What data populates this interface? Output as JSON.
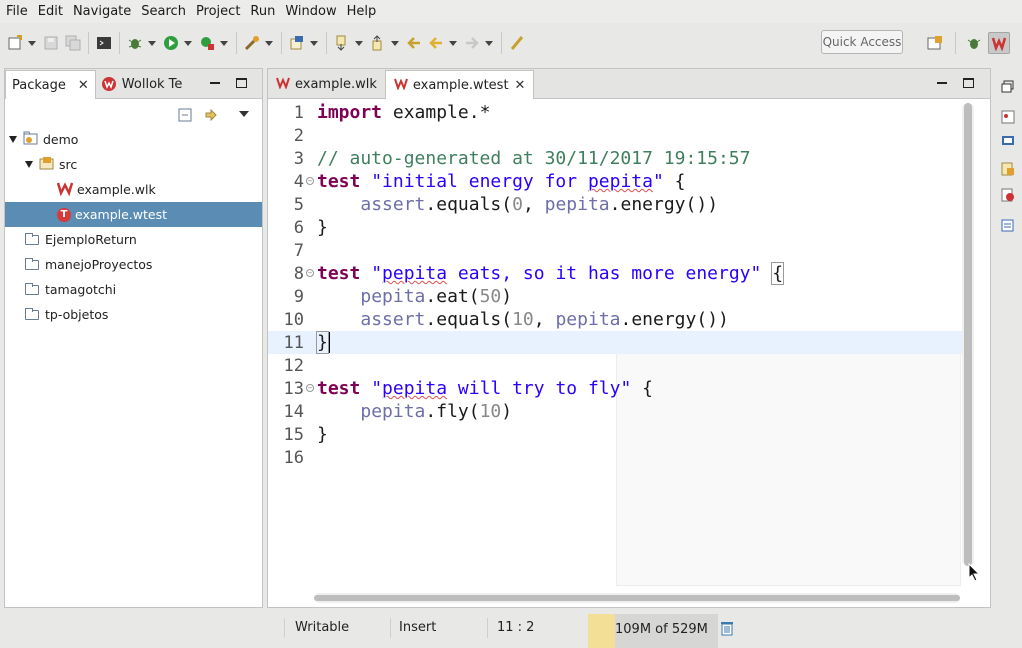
{
  "menu": [
    "File",
    "Edit",
    "Navigate",
    "Search",
    "Project",
    "Run",
    "Window",
    "Help"
  ],
  "toolbar": {
    "quick_access": "Quick Access",
    "icons": [
      "new-icon",
      "save-icon",
      "save-all-icon",
      "terminal-icon",
      "debug-icon",
      "run-icon",
      "external-tools-icon",
      "open-type-icon",
      "open-task-icon",
      "next-annotation-icon",
      "previous-annotation-icon",
      "last-edit-icon",
      "back-icon",
      "forward-icon",
      "pin-icon",
      "open-perspective-icon",
      "debug-perspective-icon",
      "wollok-perspective-icon"
    ]
  },
  "left_panel": {
    "tabs": [
      {
        "label": "Package",
        "active": true
      },
      {
        "label": "Wollok Te",
        "active": false
      }
    ],
    "tree": [
      {
        "label": "demo",
        "depth": 0,
        "expanded": true,
        "icon": "project-icon"
      },
      {
        "label": "src",
        "depth": 1,
        "expanded": true,
        "icon": "source-folder-icon"
      },
      {
        "label": "example.wlk",
        "depth": 2,
        "icon": "wollok-file-icon"
      },
      {
        "label": "example.wtest",
        "depth": 2,
        "icon": "wollok-test-icon",
        "selected": true
      },
      {
        "label": "EjemploReturn",
        "depth": 0,
        "icon": "folder-icon"
      },
      {
        "label": "manejoProyectos",
        "depth": 0,
        "icon": "folder-icon"
      },
      {
        "label": "tamagotchi",
        "depth": 0,
        "icon": "folder-icon"
      },
      {
        "label": "tp-objetos",
        "depth": 0,
        "icon": "folder-icon"
      }
    ]
  },
  "editor": {
    "tabs": [
      {
        "label": "example.wlk",
        "active": false
      },
      {
        "label": "example.wtest",
        "active": true
      }
    ],
    "current_line": 11,
    "lines": [
      {
        "n": "1",
        "text": "import example.*"
      },
      {
        "n": "2",
        "text": ""
      },
      {
        "n": "3",
        "text": "// auto-generated at 30/11/2017 19:15:57"
      },
      {
        "n": "4",
        "text": "test \"initial energy for pepita\" {"
      },
      {
        "n": "5",
        "text": "    assert.equals(0, pepita.energy())"
      },
      {
        "n": "6",
        "text": "}"
      },
      {
        "n": "7",
        "text": ""
      },
      {
        "n": "8",
        "text": "test \"pepita eats, so it has more energy\" {"
      },
      {
        "n": "9",
        "text": "    pepita.eat(50)"
      },
      {
        "n": "10",
        "text": "    assert.equals(10, pepita.energy())"
      },
      {
        "n": "11",
        "text": "}"
      },
      {
        "n": "12",
        "text": ""
      },
      {
        "n": "13",
        "text": "test \"pepita will try to fly\" {"
      },
      {
        "n": "14",
        "text": "    pepita.fly(10)"
      },
      {
        "n": "15",
        "text": "}"
      },
      {
        "n": "16",
        "text": ""
      }
    ]
  },
  "status": {
    "writable": "Writable",
    "insert_mode": "Insert",
    "position": "11 : 2",
    "heap": "109M of 529M",
    "heap_used_fraction": 0.206
  },
  "colors": {
    "keyword": "#7f0055",
    "string": "#2a00ff",
    "comment": "#3f7f5f",
    "reference": "#6e6ea8",
    "selection": "#5b8db4",
    "current_line": "#e8f2fe"
  }
}
